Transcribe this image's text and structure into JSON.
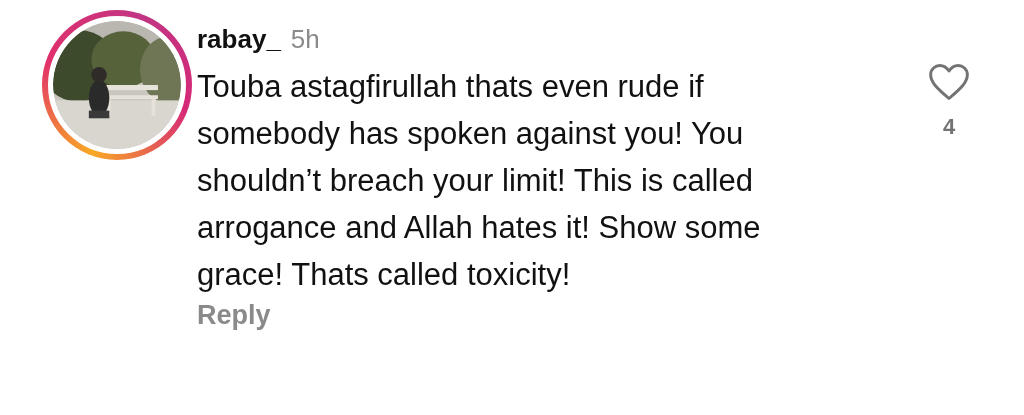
{
  "comment": {
    "username": "rabay_",
    "time": "5h",
    "text": "Touba astagfirullah thats even rude if somebody has spoken against you! You shouldn’t breach your limit! This is called arrogance and Allah hates it! Show some grace! Thats called toxicity!",
    "likes": "4",
    "reply": "Reply"
  }
}
